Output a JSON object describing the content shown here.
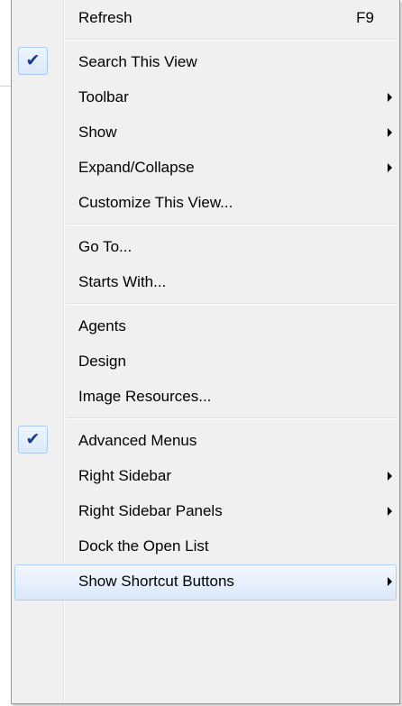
{
  "menu": {
    "groups": [
      [
        {
          "label": "Refresh",
          "shortcut": "F9"
        }
      ],
      [
        {
          "label": "Search This View",
          "checked": true
        },
        {
          "label": "Toolbar",
          "submenu": true
        },
        {
          "label": "Show",
          "submenu": true
        },
        {
          "label": "Expand/Collapse",
          "submenu": true
        },
        {
          "label": "Customize This View..."
        }
      ],
      [
        {
          "label": "Go To..."
        },
        {
          "label": "Starts With..."
        }
      ],
      [
        {
          "label": "Agents"
        },
        {
          "label": "Design"
        },
        {
          "label": "Image Resources..."
        }
      ],
      [
        {
          "label": "Advanced Menus",
          "checked": true
        },
        {
          "label": "Right Sidebar",
          "submenu": true
        },
        {
          "label": "Right Sidebar Panels",
          "submenu": true
        },
        {
          "label": "Dock the Open List"
        },
        {
          "label": "Show Shortcut Buttons",
          "submenu": true,
          "highlighted": true
        }
      ]
    ],
    "check_icon": "checkmark-icon",
    "submenu_icon": "submenu-arrow-icon",
    "colors": {
      "menu_background": "#f0f0f0",
      "check_color": "#1c3c8c",
      "highlight_border": "#aecff7"
    }
  }
}
